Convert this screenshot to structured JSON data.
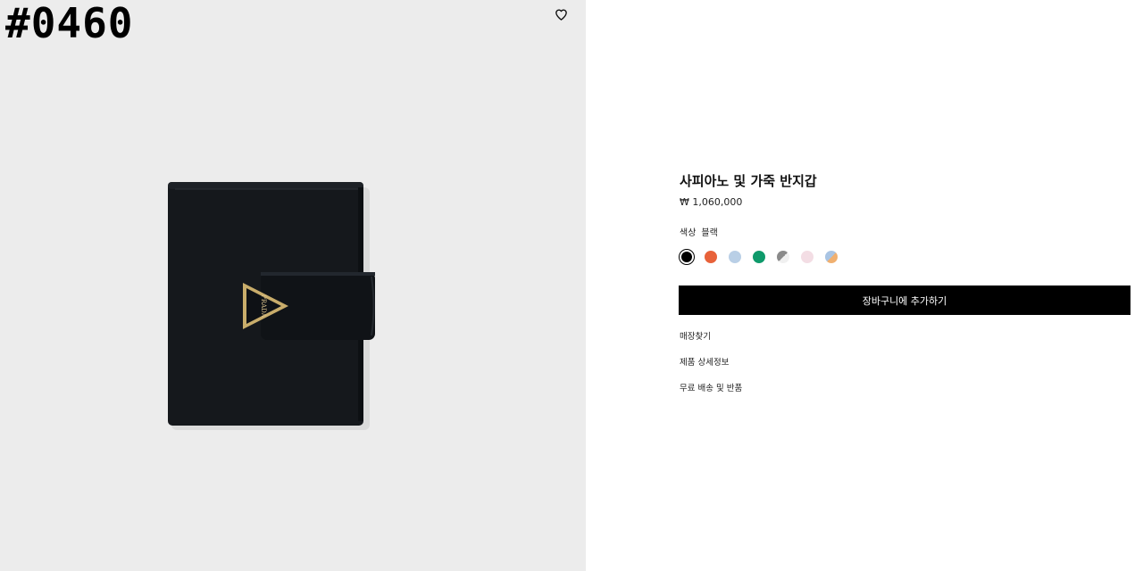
{
  "overlay_label": "#0460",
  "image_panel": {
    "wishlist_icon": "heart-outline-icon",
    "background_color": "#ececec",
    "product_image": {
      "subject": "black saffiano leather bi-fold wallet with enamel triangle logo clasp",
      "logo_text": "PRADA"
    }
  },
  "product": {
    "title": "사피아노 및 가죽 반지갑",
    "price": "₩ 1,060,000",
    "color_label": "색상",
    "color_value": "블랙",
    "swatches": [
      {
        "name": "black",
        "colors": [
          "#000000"
        ],
        "selected": true
      },
      {
        "name": "orange",
        "colors": [
          "#e8623a"
        ],
        "selected": false
      },
      {
        "name": "light-blue",
        "colors": [
          "#b9cfe6"
        ],
        "selected": false
      },
      {
        "name": "green",
        "colors": [
          "#0f9a6b"
        ],
        "selected": false
      },
      {
        "name": "grey-white",
        "colors": [
          "#8a8a8a",
          "#f0f0f0"
        ],
        "selected": false
      },
      {
        "name": "light-pink",
        "colors": [
          "#f3dde4"
        ],
        "selected": false
      },
      {
        "name": "blue-orange",
        "colors": [
          "#a9c4e3",
          "#f0b070"
        ],
        "selected": false
      }
    ],
    "add_to_cart_label": "장바구니에 추가하기"
  },
  "links": {
    "find_store": "매장찾기",
    "product_details": "제품 상세정보",
    "shipping_returns": "무료 배송 및 반품"
  }
}
